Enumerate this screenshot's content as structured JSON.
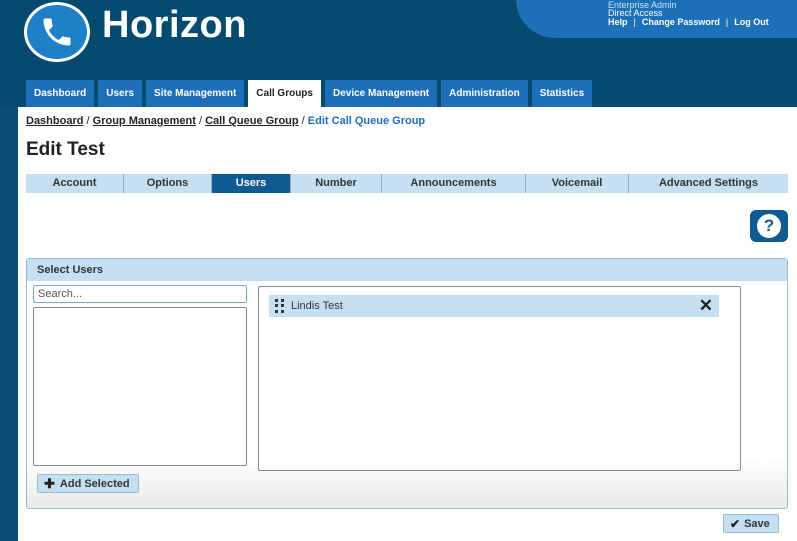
{
  "header": {
    "app_name": "Horizon",
    "user_line1": "Enterprise Admin",
    "user_line2": "Direct Access",
    "links": {
      "help": "Help",
      "change_password": "Change Password",
      "logout": "Log Out"
    }
  },
  "nav": {
    "tabs": [
      {
        "label": "Dashboard",
        "active": false
      },
      {
        "label": "Users",
        "active": false
      },
      {
        "label": "Site Management",
        "active": false
      },
      {
        "label": "Call Groups",
        "active": true
      },
      {
        "label": "Device Management",
        "active": false
      },
      {
        "label": "Administration",
        "active": false
      },
      {
        "label": "Statistics",
        "active": false
      }
    ]
  },
  "breadcrumb": {
    "items": [
      "Dashboard",
      "Group Management",
      "Call Queue Group"
    ],
    "separator": " / ",
    "current": "Edit Call Queue Group"
  },
  "page_title": "Edit Test",
  "subtabs": [
    {
      "label": "Account",
      "active": false
    },
    {
      "label": "Options",
      "active": false
    },
    {
      "label": "Users",
      "active": true
    },
    {
      "label": "Number",
      "active": false
    },
    {
      "label": "Announcements",
      "active": false
    },
    {
      "label": "Voicemail",
      "active": false
    },
    {
      "label": "Advanced Settings",
      "active": false
    }
  ],
  "help_button": {
    "icon": "question-icon",
    "glyph": "?"
  },
  "select_users": {
    "heading": "Select Users",
    "search_placeholder": "Search...",
    "available_users": [],
    "selected_users": [
      "Lindis Test"
    ],
    "add_selected_label": "Add Selected"
  },
  "save_label": "Save",
  "colors": {
    "header_bg": "#074a70",
    "tab_blue": "#1d6fb8",
    "light_blue": "#c4e0f2",
    "active_subtab": "#0e5a92"
  }
}
